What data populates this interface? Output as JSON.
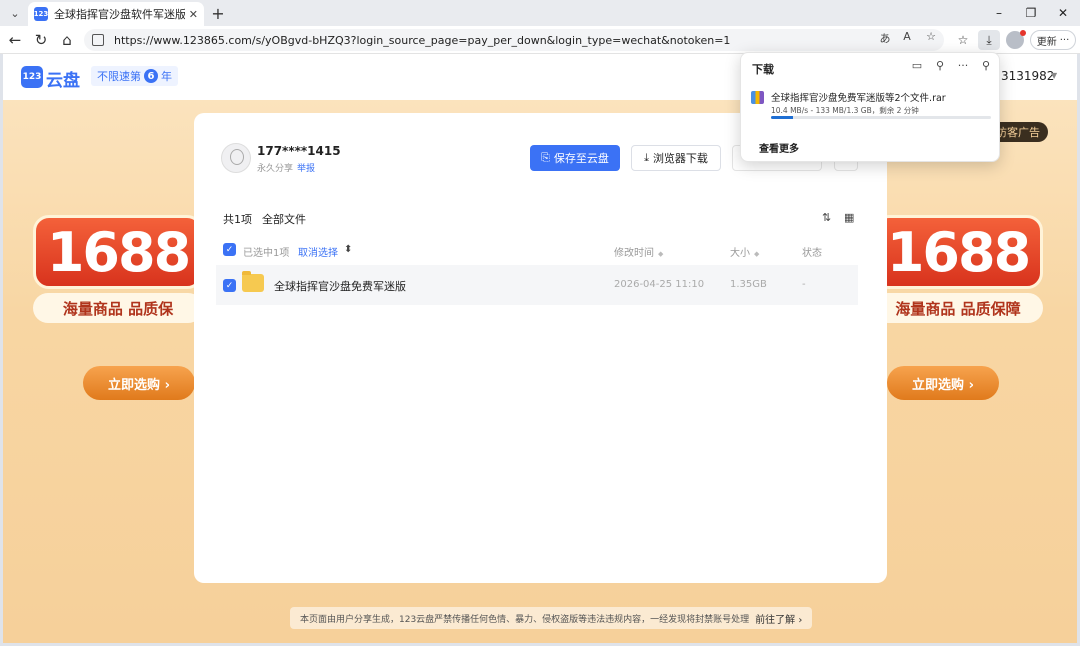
{
  "browser": {
    "tab_title": "全球指挥官沙盘软件军迷版_123云盘",
    "favicon_text": "123",
    "url": "https://www.123865.com/s/yOBgvd-bHZQ3?login_source_page=pay_per_down&login_type=wechat&notoken=1",
    "update_label": "更新"
  },
  "site": {
    "logo_mark": "123",
    "logo_text": "云盘",
    "slogan": "不限速第",
    "slogan_num": "6",
    "slogan_suffix": "年",
    "user_id": "3131982"
  },
  "promo": {
    "number": "1688",
    "sub_left": "海量商品 品质保",
    "sub_right": "海量商品 品质保障",
    "cta": "立即选购 ›",
    "guest_ad": "访客广告"
  },
  "share": {
    "sharer": "177****1415",
    "meta": "永久分享",
    "report": "举报",
    "save_button": "保存至云盘",
    "download_button": "浏览器下载"
  },
  "files": {
    "count": "共1项",
    "breadcrumb": "全部文件",
    "selected": "已选中1项",
    "deselect": "取消选择",
    "columns": {
      "modified": "修改时间",
      "size": "大小",
      "status": "状态"
    },
    "rows": [
      {
        "name": "全球指挥官沙盘免费军迷版",
        "modified": "2026-04-25 11:10",
        "size": "1.35GB",
        "status": "-"
      }
    ]
  },
  "footer": {
    "notice": "本页面由用户分享生成，123云盘严禁传播任何色情、暴力、侵权盗版等违法违规内容，一经发现将封禁账号处理",
    "link": "前往了解 ›"
  },
  "downloads": {
    "title": "下载",
    "file_name": "全球指挥官沙盘免费军迷版等2个文件.rar",
    "status": "10.4 MB/s - 133 MB/1.3 GB，剩余 2 分钟",
    "progress": 0.1,
    "see_more": "查看更多"
  },
  "colors": {
    "accent": "#3b72f5",
    "promo_red": "#d8331d",
    "promo_orange": "#e07a1c"
  }
}
